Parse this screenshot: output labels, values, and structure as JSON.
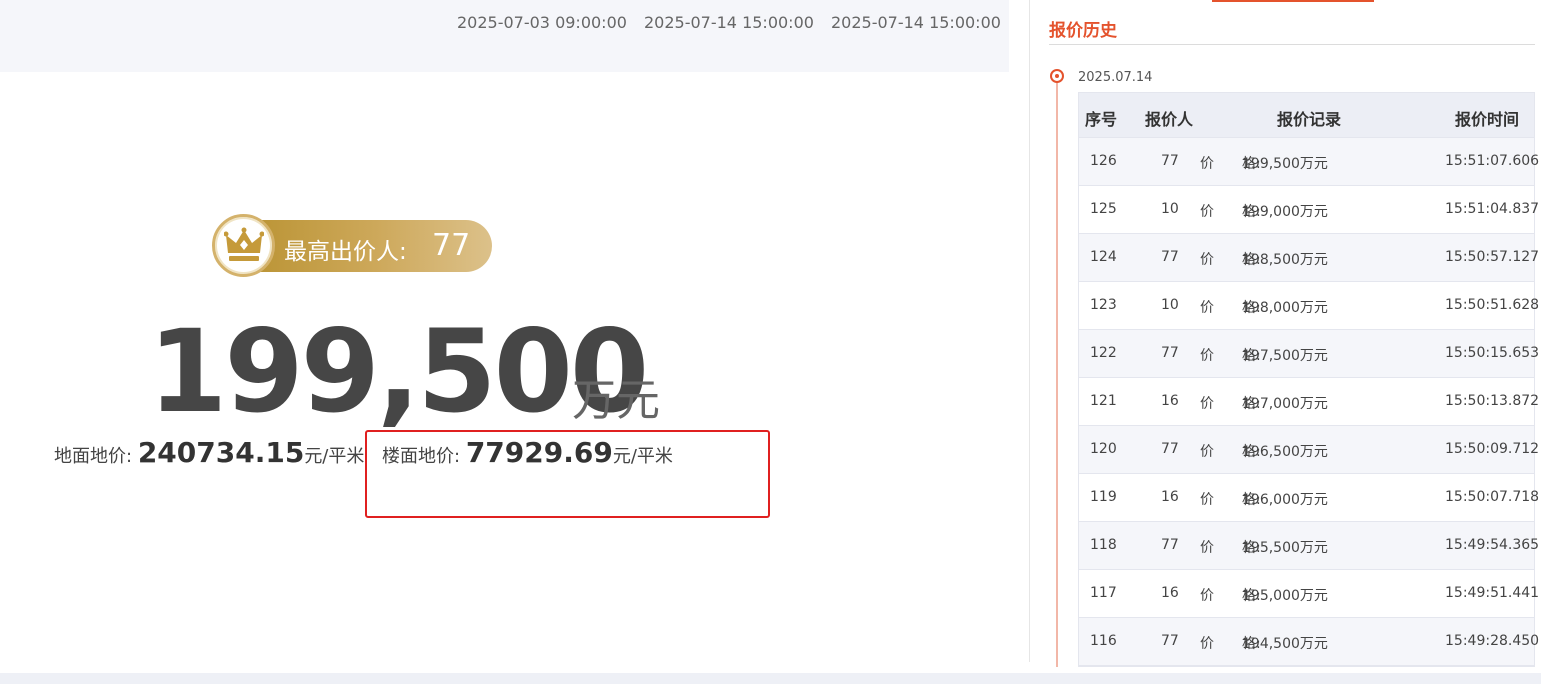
{
  "top_times": [
    "2025-07-03 09:00:00",
    "2025-07-14 15:00:00",
    "2025-07-14 15:00:00"
  ],
  "bidder": {
    "label": "最高出价人:",
    "value": "77"
  },
  "price": {
    "value": "199,500",
    "unit": "万元"
  },
  "ground_price": {
    "label": "地面地价:",
    "value": "240734.15",
    "unit": "元/平米"
  },
  "floor_price": {
    "label": "楼面地价:",
    "value": "77929.69",
    "unit": "元/平米"
  },
  "history": {
    "title": "报价历史",
    "date": "2025.07.14",
    "columns": {
      "no": "序号",
      "bidder": "报价人",
      "record": "报价记录",
      "time": "报价时间"
    },
    "price_label": "价　　格:",
    "rows": [
      {
        "no": "126",
        "bidder": "77",
        "price": "199,500万元",
        "time": "15:51:07.606"
      },
      {
        "no": "125",
        "bidder": "10",
        "price": "199,000万元",
        "time": "15:51:04.837"
      },
      {
        "no": "124",
        "bidder": "77",
        "price": "198,500万元",
        "time": "15:50:57.127"
      },
      {
        "no": "123",
        "bidder": "10",
        "price": "198,000万元",
        "time": "15:50:51.628"
      },
      {
        "no": "122",
        "bidder": "77",
        "price": "197,500万元",
        "time": "15:50:15.653"
      },
      {
        "no": "121",
        "bidder": "16",
        "price": "197,000万元",
        "time": "15:50:13.872"
      },
      {
        "no": "120",
        "bidder": "77",
        "price": "196,500万元",
        "time": "15:50:09.712"
      },
      {
        "no": "119",
        "bidder": "16",
        "price": "196,000万元",
        "time": "15:50:07.718"
      },
      {
        "no": "118",
        "bidder": "77",
        "price": "195,500万元",
        "time": "15:49:54.365"
      },
      {
        "no": "117",
        "bidder": "16",
        "price": "195,000万元",
        "time": "15:49:51.441"
      },
      {
        "no": "116",
        "bidder": "77",
        "price": "194,500万元",
        "time": "15:49:28.450"
      }
    ]
  },
  "colors": {
    "accent": "#e4532d",
    "highlight_box": "#e02020",
    "gold": "#c9a24f"
  },
  "icons": {
    "crown": "crown-icon"
  }
}
